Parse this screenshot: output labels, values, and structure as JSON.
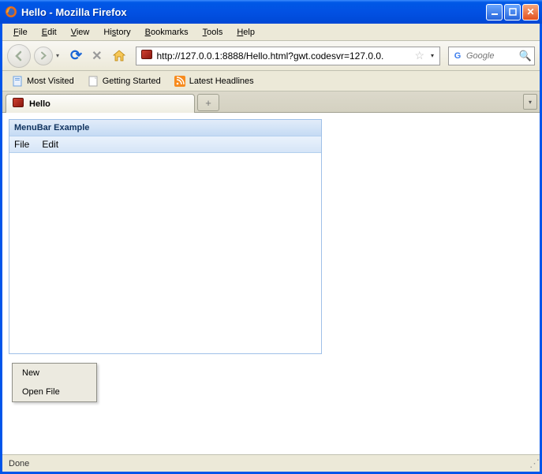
{
  "window": {
    "title": "Hello - Mozilla Firefox"
  },
  "menubar": {
    "file": "File",
    "edit": "Edit",
    "view": "View",
    "history": "History",
    "bookmarks": "Bookmarks",
    "tools": "Tools",
    "help": "Help"
  },
  "url": "http://127.0.0.1:8888/Hello.html?gwt.codesvr=127.0.0.",
  "search": {
    "placeholder": "Google"
  },
  "bookmarks": {
    "most_visited": "Most Visited",
    "getting_started": "Getting Started",
    "latest_headlines": "Latest Headlines"
  },
  "tab": {
    "title": "Hello"
  },
  "panel": {
    "title": "MenuBar Example",
    "menu_file": "File",
    "menu_edit": "Edit"
  },
  "popup": {
    "item1": "New",
    "item2": "Open File"
  },
  "status": "Done"
}
